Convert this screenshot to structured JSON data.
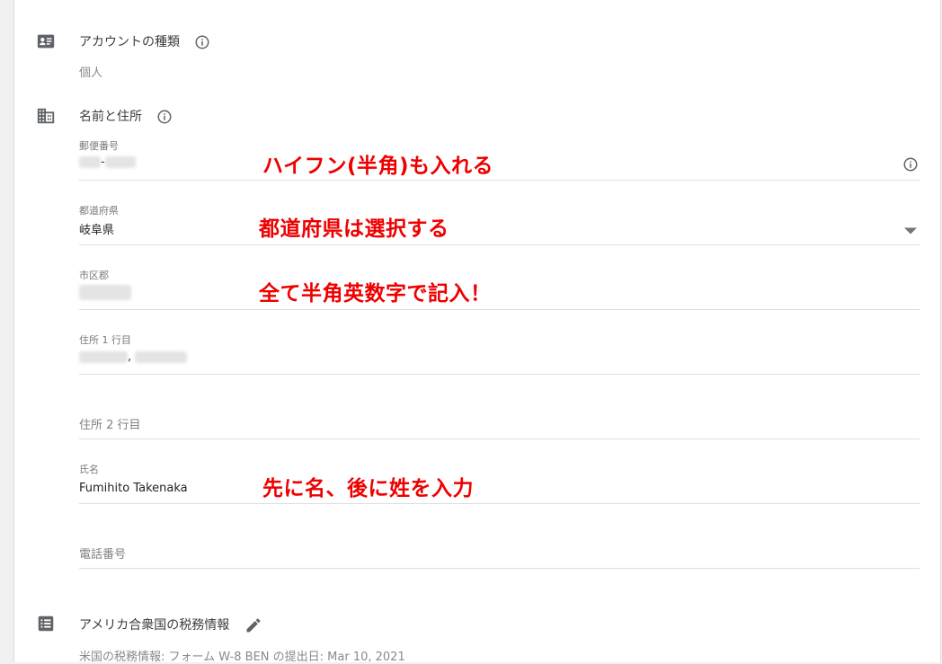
{
  "account_type": {
    "title": "アカウントの種類",
    "value": "個人"
  },
  "name_address": {
    "title": "名前と住所",
    "fields": {
      "postal": {
        "label": "郵便番号",
        "separator": "-"
      },
      "prefecture": {
        "label": "都道府県",
        "value": "岐阜県"
      },
      "city": {
        "label": "市区郡"
      },
      "address1": {
        "label": "住所 1 行目",
        "separator": ","
      },
      "address2": {
        "placeholder": "住所 2 行目"
      },
      "name": {
        "label": "氏名",
        "value": "Fumihito Takenaka"
      },
      "phone": {
        "placeholder": "電話番号"
      }
    }
  },
  "us_tax": {
    "title": "アメリカ合衆国の税務情報",
    "value": "米国の税務情報: フォーム W-8 BEN の提出日: Mar 10, 2021"
  },
  "annotations": {
    "postal": "ハイフン(半角)も入れる",
    "prefecture": "都道府県は選択する",
    "city": "全て半角英数字で記入！",
    "name": "先に名、後に姓を入力"
  },
  "colors": {
    "annotation": "#ee0000",
    "icon": "#5f6368"
  }
}
